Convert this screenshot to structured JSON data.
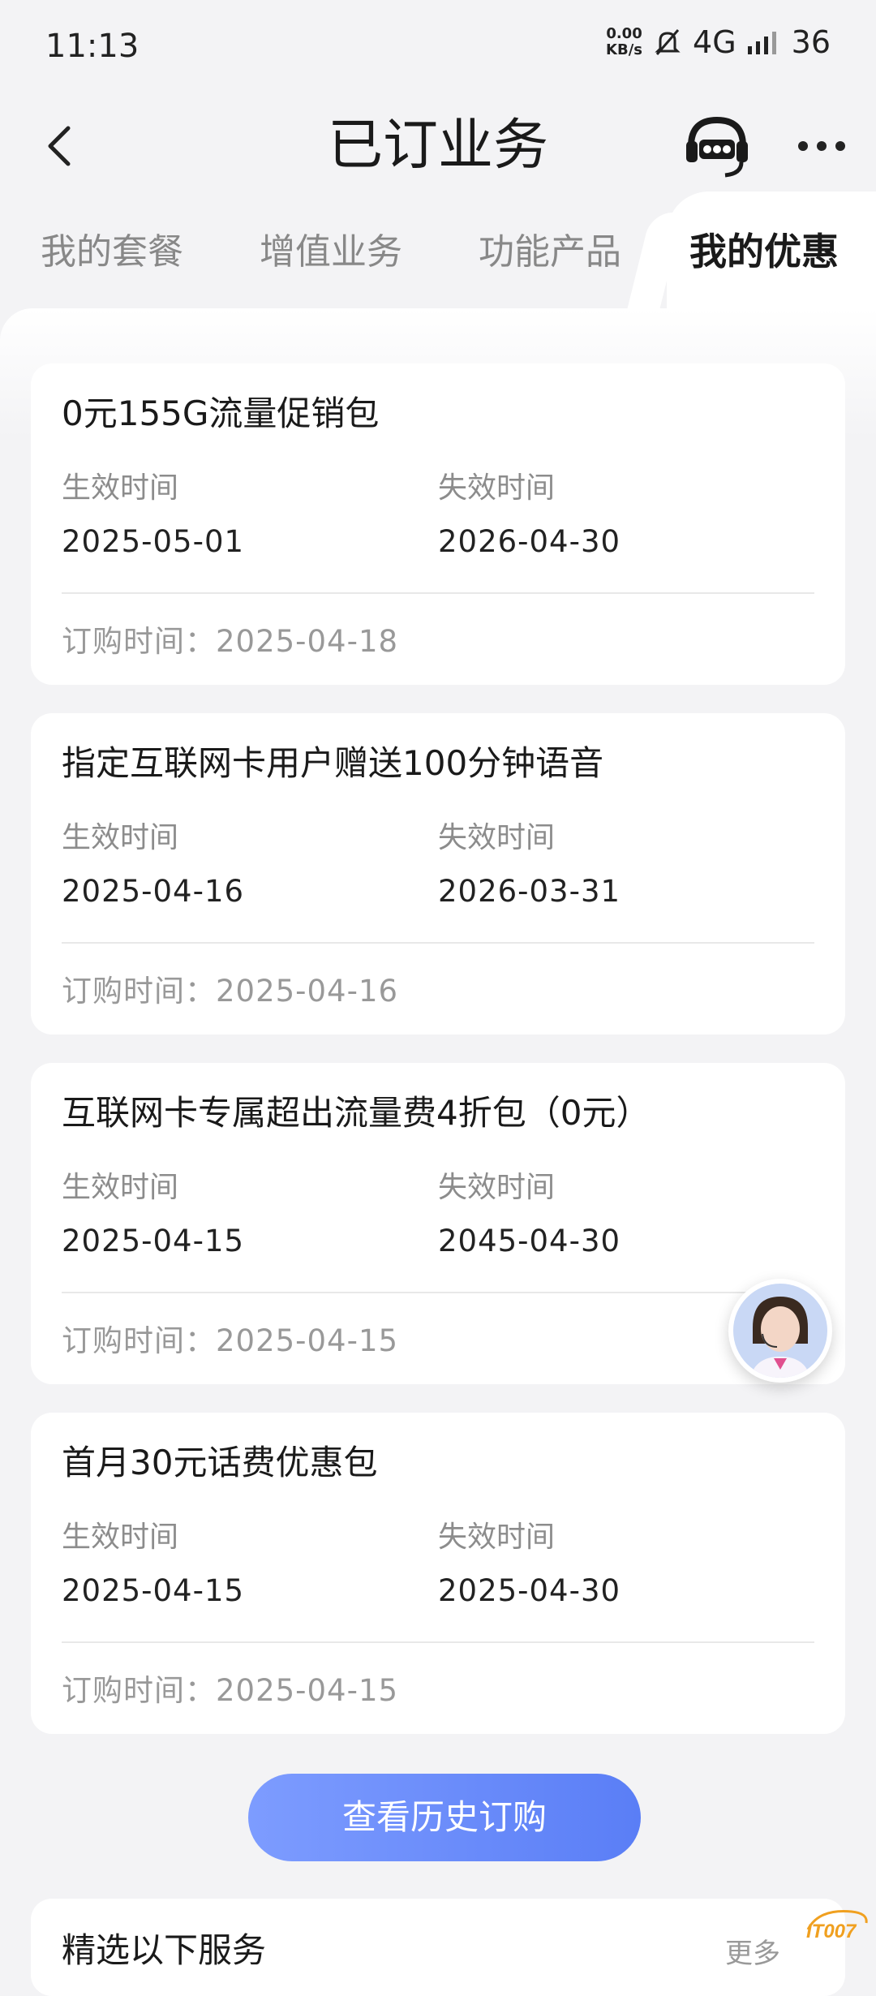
{
  "status_bar": {
    "time": "11:13",
    "net_speed_value": "0.00",
    "net_speed_unit": "KB/s",
    "network": "4G",
    "battery": "36"
  },
  "header": {
    "title": "已订业务",
    "service_icon": "10000-headset-icon",
    "more_icon": "more-dots-icon"
  },
  "tabs": [
    {
      "label": "我的套餐",
      "active": false
    },
    {
      "label": "增值业务",
      "active": false
    },
    {
      "label": "功能产品",
      "active": false
    },
    {
      "label": "我的优惠",
      "active": true
    }
  ],
  "labels": {
    "effective": "生效时间",
    "expiry": "失效时间",
    "order_prefix": "订购时间："
  },
  "cards": [
    {
      "title": "0元155G流量促销包",
      "effective": "2025-05-01",
      "expiry": "2026-04-30",
      "ordered": "2025-04-18"
    },
    {
      "title": "指定互联网卡用户赠送100分钟语音",
      "effective": "2025-04-16",
      "expiry": "2026-03-31",
      "ordered": "2025-04-16"
    },
    {
      "title": "互联网卡专属超出流量费4折包（0元）",
      "effective": "2025-04-15",
      "expiry": "2045-04-30",
      "ordered": "2025-04-15"
    },
    {
      "title": "首月30元话费优惠包",
      "effective": "2025-04-15",
      "expiry": "2025-04-30",
      "ordered": "2025-04-15"
    }
  ],
  "history_button": "查看历史订购",
  "recommend": {
    "title": "精选以下服务",
    "more": "更多"
  },
  "watermark": "IT007",
  "colors": {
    "accent_start": "#7d9cff",
    "accent_end": "#5a7ef6",
    "background": "#f3f3f5"
  }
}
